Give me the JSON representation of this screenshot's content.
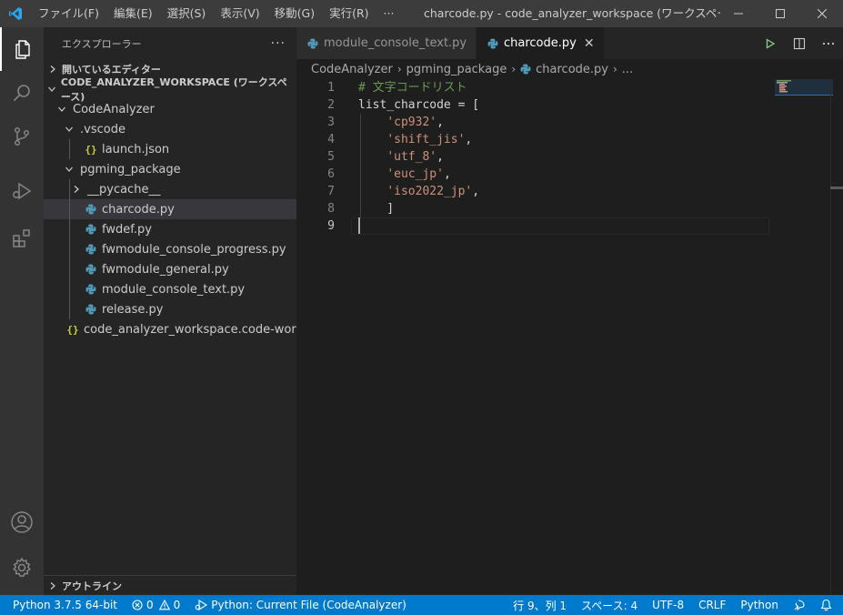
{
  "window": {
    "title": "charcode.py - code_analyzer_workspace (ワークスペース) - Vis...",
    "menu": [
      "ファイル(F)",
      "編集(E)",
      "選択(S)",
      "表示(V)",
      "移動(G)",
      "実行(R)",
      "···"
    ]
  },
  "activity_bar": {
    "items": [
      "files-icon",
      "search-icon",
      "source-control-icon",
      "run-debug-icon",
      "extensions-icon"
    ],
    "bottom": [
      "account-icon",
      "gear-icon"
    ]
  },
  "sidebar": {
    "title": "エクスプローラー",
    "more": "···",
    "open_editors": "開いているエディター",
    "workspace": "CODE_ANALYZER_WORKSPACE (ワークスペース)",
    "tree": [
      {
        "label": "CodeAnalyzer",
        "depth": 1,
        "kind": "folder-open"
      },
      {
        "label": ".vscode",
        "depth": 2,
        "kind": "folder-open"
      },
      {
        "label": "launch.json",
        "depth": 3,
        "kind": "json"
      },
      {
        "label": "pgming_package",
        "depth": 2,
        "kind": "folder-open"
      },
      {
        "label": "__pycache__",
        "depth": 3,
        "kind": "folder-closed"
      },
      {
        "label": "charcode.py",
        "depth": 3,
        "kind": "python",
        "selected": true
      },
      {
        "label": "fwdef.py",
        "depth": 3,
        "kind": "python"
      },
      {
        "label": "fwmodule_console_progress.py",
        "depth": 3,
        "kind": "python"
      },
      {
        "label": "fwmodule_general.py",
        "depth": 3,
        "kind": "python"
      },
      {
        "label": "module_console_text.py",
        "depth": 3,
        "kind": "python"
      },
      {
        "label": "release.py",
        "depth": 3,
        "kind": "python"
      },
      {
        "label": "code_analyzer_workspace.code-worksp...",
        "depth": 2,
        "kind": "json"
      }
    ],
    "outline": "アウトライン"
  },
  "tabs": [
    {
      "label": "module_console_text.py",
      "active": false
    },
    {
      "label": "charcode.py",
      "active": true,
      "close": "✕"
    }
  ],
  "breadcrumb": {
    "parts": [
      "CodeAnalyzer",
      "pgming_package",
      "charcode.py",
      "..."
    ],
    "sep": "›"
  },
  "code": {
    "current_line": 9,
    "lines": [
      {
        "n": "1",
        "tokens": [
          {
            "t": "comment",
            "v": "# 文字コードリスト"
          }
        ]
      },
      {
        "n": "2",
        "tokens": [
          {
            "t": "var",
            "v": "list_charcode"
          },
          {
            "t": "punc",
            "v": " = ["
          }
        ]
      },
      {
        "n": "3",
        "tokens": [
          {
            "t": "punc",
            "v": "    "
          },
          {
            "t": "str",
            "v": "'cp932'"
          },
          {
            "t": "punc",
            "v": ","
          }
        ]
      },
      {
        "n": "4",
        "tokens": [
          {
            "t": "punc",
            "v": "    "
          },
          {
            "t": "str",
            "v": "'shift_jis'"
          },
          {
            "t": "punc",
            "v": ","
          }
        ]
      },
      {
        "n": "5",
        "tokens": [
          {
            "t": "punc",
            "v": "    "
          },
          {
            "t": "str",
            "v": "'utf_8'"
          },
          {
            "t": "punc",
            "v": ","
          }
        ]
      },
      {
        "n": "6",
        "tokens": [
          {
            "t": "punc",
            "v": "    "
          },
          {
            "t": "str",
            "v": "'euc_jp'"
          },
          {
            "t": "punc",
            "v": ","
          }
        ]
      },
      {
        "n": "7",
        "tokens": [
          {
            "t": "punc",
            "v": "    "
          },
          {
            "t": "str",
            "v": "'iso2022_jp'"
          },
          {
            "t": "punc",
            "v": ","
          }
        ]
      },
      {
        "n": "8",
        "tokens": [
          {
            "t": "punc",
            "v": "    ]"
          }
        ]
      },
      {
        "n": "9",
        "tokens": []
      }
    ]
  },
  "status": {
    "python": "Python 3.7.5 64-bit",
    "errors": "0",
    "warnings": "0",
    "debug": "Python: Current File (CodeAnalyzer)",
    "position": "行 9、列 1",
    "spaces": "スペース: 4",
    "encoding": "UTF-8",
    "eol": "CRLF",
    "language": "Python"
  },
  "colors": {
    "accent": "#007acc",
    "vscode_logo": "#23a9f2",
    "python_blue": "#519aba",
    "json_yellow": "#cbcb41",
    "run_green": "#89d185"
  }
}
